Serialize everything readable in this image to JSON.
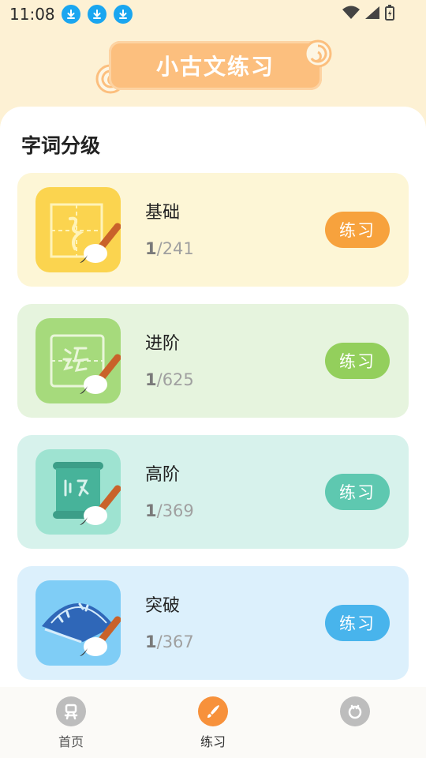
{
  "status_bar": {
    "time": "11:08"
  },
  "header": {
    "title": "小古文练习"
  },
  "section": {
    "title": "字词分级"
  },
  "levels": [
    {
      "name": "基础",
      "current": "1",
      "total": "/241",
      "button": "练习",
      "bg": "#fdf6d6",
      "btn_color": "#f7a23d",
      "icon_bg": "#fbd44f"
    },
    {
      "name": "进阶",
      "current": "1",
      "total": "/625",
      "button": "练习",
      "bg": "#e6f4de",
      "btn_color": "#93cf5c",
      "icon_bg": "#a6da7c"
    },
    {
      "name": "高阶",
      "current": "1",
      "total": "/369",
      "button": "练习",
      "bg": "#d7f2ec",
      "btn_color": "#5ec8b0",
      "icon_bg": "#9ee3d1"
    },
    {
      "name": "突破",
      "current": "1",
      "total": "/367",
      "button": "练习",
      "bg": "#dcf0fc",
      "btn_color": "#48b4ec",
      "icon_bg": "#7fcdf6"
    }
  ],
  "nav": {
    "home_label": "首页",
    "practice_label": "练习",
    "accent": "#f7913b"
  }
}
